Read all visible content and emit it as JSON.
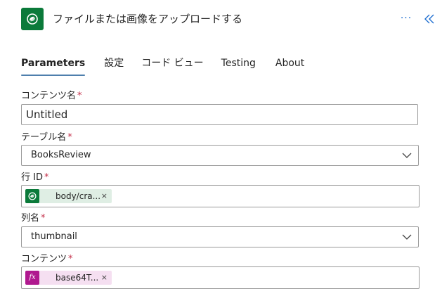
{
  "header": {
    "title": "ファイルまたは画像をアップロードする",
    "more_label": "···",
    "app_icon": "dataverse-icon",
    "collapse_icon": "double-chevron-left-icon"
  },
  "tabs": [
    {
      "label": "Parameters",
      "active": true
    },
    {
      "label": "設定",
      "active": false
    },
    {
      "label": "コード ビュー",
      "active": false
    },
    {
      "label": "Testing",
      "active": false
    },
    {
      "label": "About",
      "active": false
    }
  ],
  "fields": {
    "content_name": {
      "label": "コンテンツ名",
      "required": "*",
      "value": "Untitled"
    },
    "table_name": {
      "label": "テーブル名",
      "required": "*",
      "value": "BooksReview"
    },
    "row_id": {
      "label": "行 ID",
      "required": "*",
      "token": "body/cra...",
      "token_icon": "dataverse-icon",
      "remove": "×"
    },
    "column_name": {
      "label": "列名",
      "required": "*",
      "value": "thumbnail"
    },
    "content": {
      "label": "コンテンツ",
      "required": "*",
      "token": "base64T...",
      "token_icon": "fx-icon",
      "token_icon_text": "fx",
      "remove": "×"
    }
  },
  "colors": {
    "accent": "#1f6fd1",
    "tab_underline": "#4e7fad",
    "dataverse_green": "#0b7a3a",
    "expression_purple": "#b0198f",
    "required_red": "#c4314b"
  }
}
